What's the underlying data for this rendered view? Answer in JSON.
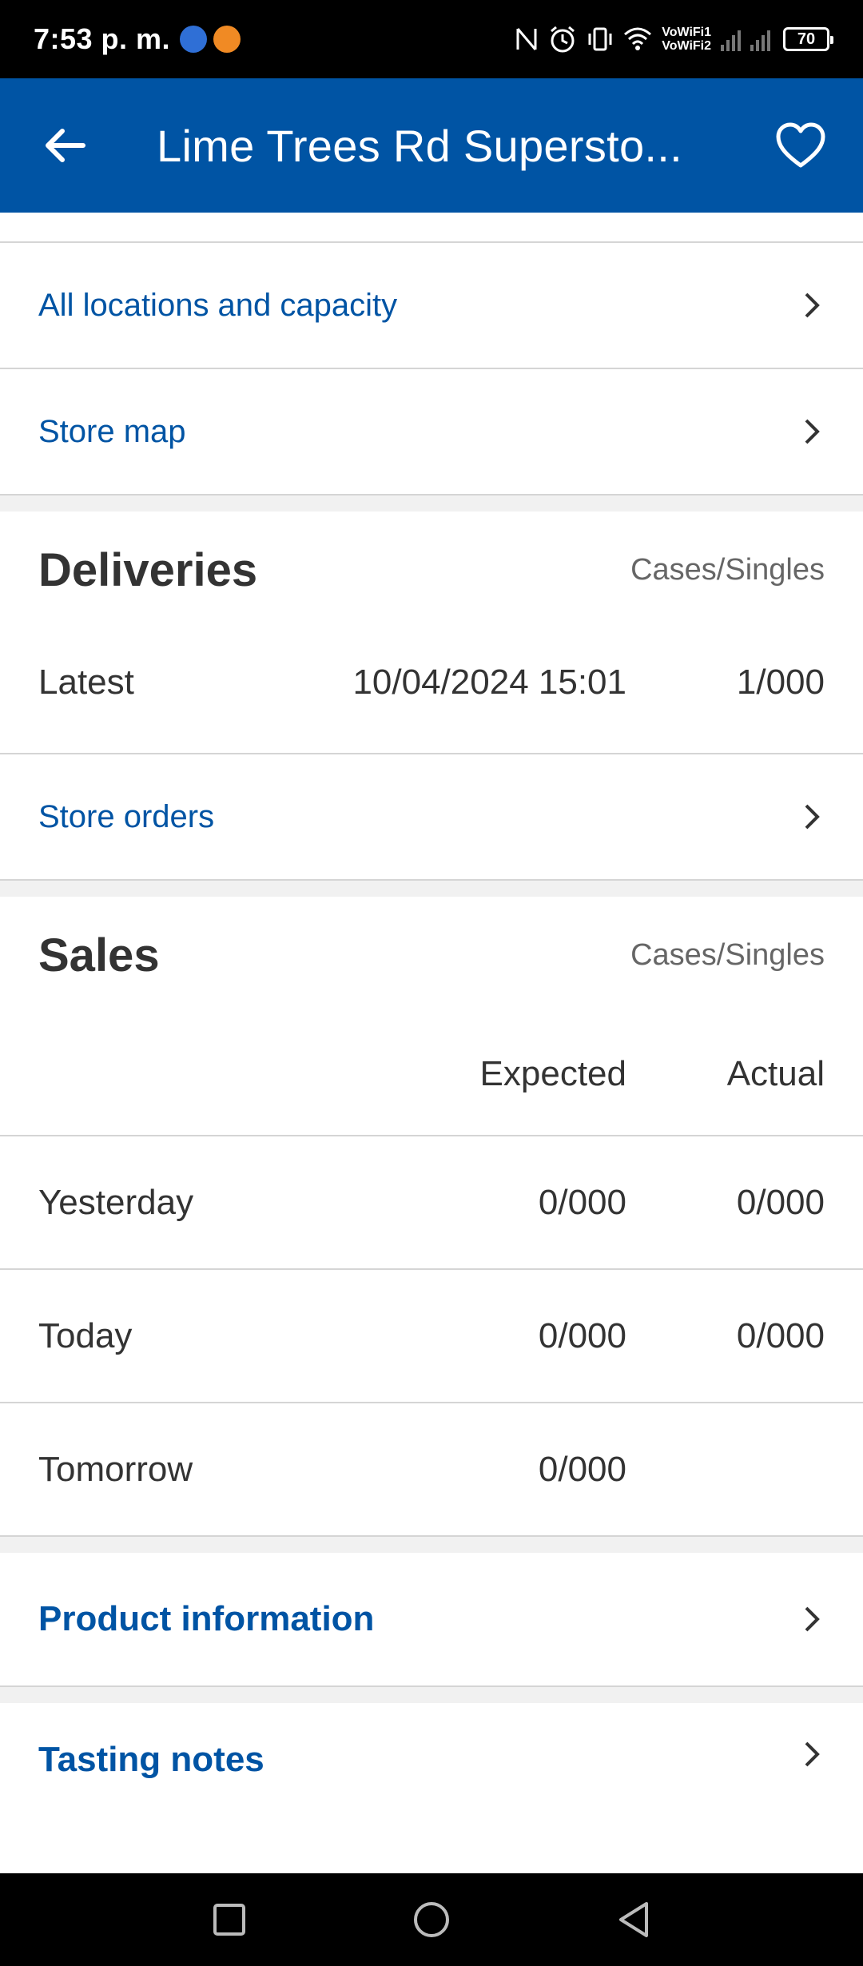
{
  "status_bar": {
    "time": "7:53 p. m.",
    "vowifi_1": "VoWiFi1",
    "vowifi_2": "VoWiFi2",
    "battery": "70"
  },
  "app_bar": {
    "title": "Lime Trees Rd Supersto...",
    "back_icon": "arrow-left-icon",
    "favorite_icon": "heart-outline-icon"
  },
  "links": {
    "all_locations": "All locations and capacity",
    "store_map": "Store map",
    "store_orders": "Store orders",
    "product_information": "Product information",
    "tasting_notes": "Tasting notes"
  },
  "deliveries": {
    "title": "Deliveries",
    "unit": "Cases/Singles",
    "rows": [
      {
        "label": "Latest",
        "date": "10/04/2024 15:01",
        "value": "1/000"
      }
    ]
  },
  "sales": {
    "title": "Sales",
    "unit": "Cases/Singles",
    "col_expected": "Expected",
    "col_actual": "Actual",
    "rows": [
      {
        "label": "Yesterday",
        "expected": "0/000",
        "actual": "0/000"
      },
      {
        "label": "Today",
        "expected": "0/000",
        "actual": "0/000"
      },
      {
        "label": "Tomorrow",
        "expected": "0/000",
        "actual": ""
      }
    ]
  },
  "colors": {
    "brand": "#0054a4",
    "link": "#0054a4",
    "text": "#333333",
    "muted": "#666666",
    "divider": "#d5d5d5",
    "section_gap": "#f1f1f1"
  }
}
